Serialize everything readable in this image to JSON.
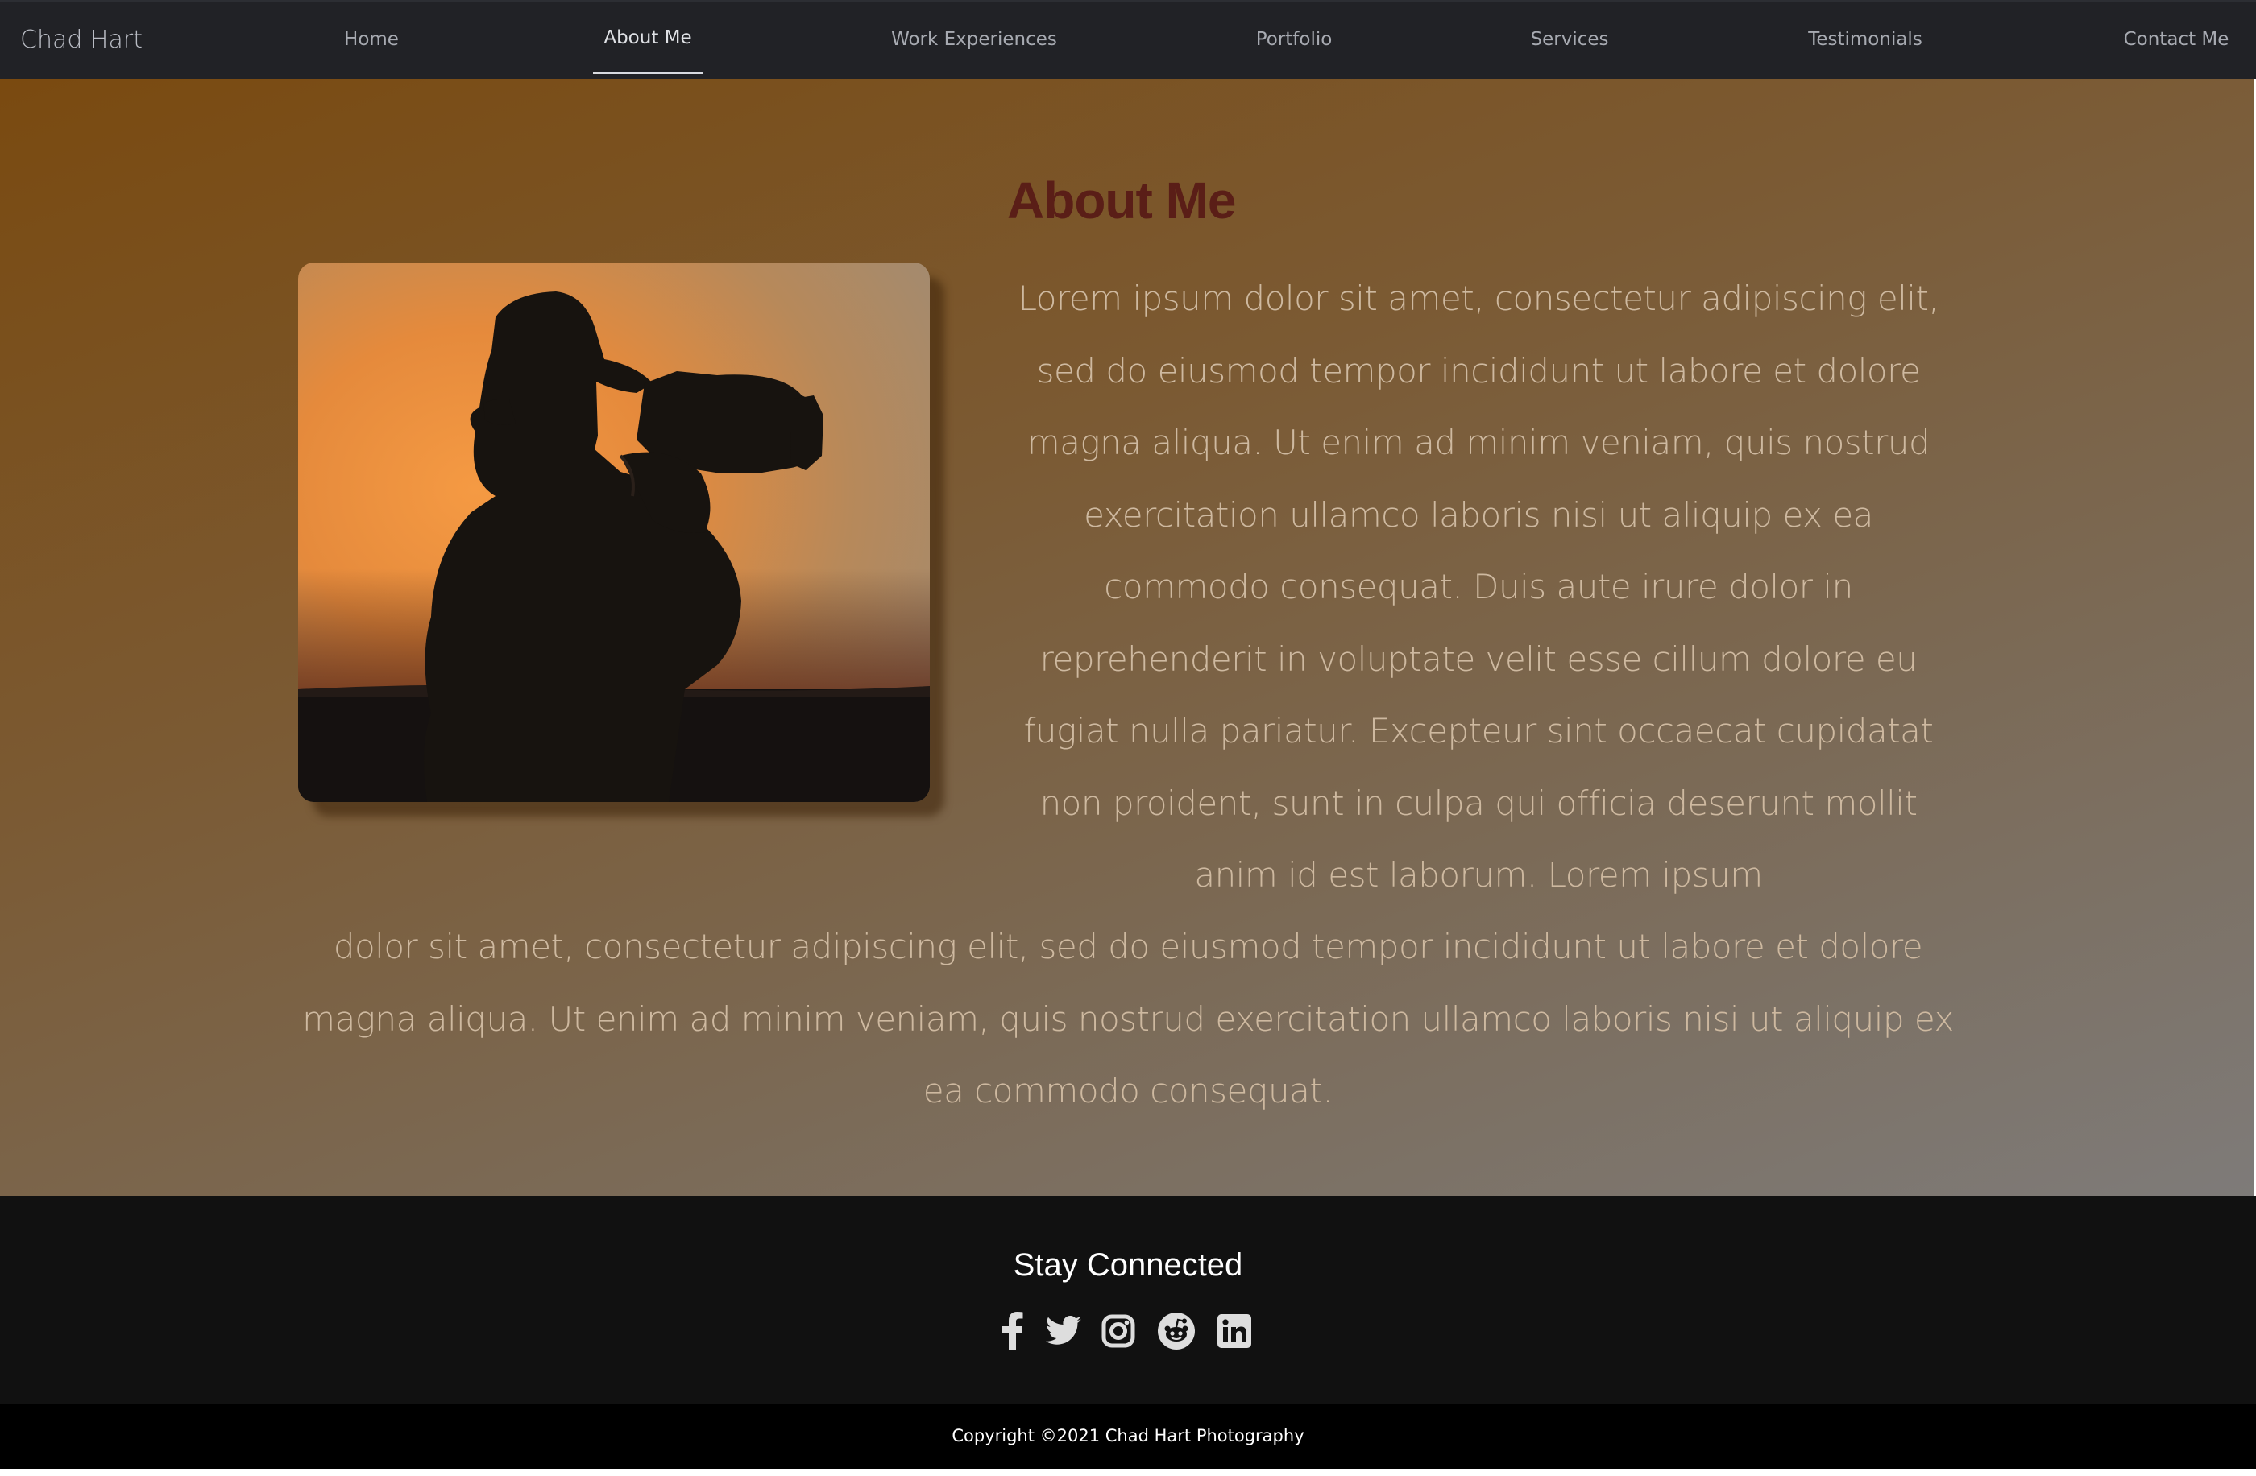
{
  "navbar": {
    "brand": "Chad Hart",
    "items": [
      {
        "label": "Home"
      },
      {
        "label": "About Me"
      },
      {
        "label": "Work Experiences"
      },
      {
        "label": "Portfolio"
      },
      {
        "label": "Services"
      },
      {
        "label": "Testimonials"
      },
      {
        "label": "Contact Me"
      }
    ],
    "active": "About Me"
  },
  "about": {
    "title": "About Me",
    "paragraph_top": "Lorem ipsum dolor sit amet, consectetur adipiscing elit, sed do eiusmod tempor incididunt ut labore et dolore magna aliqua. Ut enim ad minim veniam, quis nostrud exercitation ullamco laboris nisi ut aliquip ex ea commodo consequat. Duis aute irure dolor in reprehenderit in voluptate velit esse cillum dolore eu fugiat nulla pariatur. Excepteur sint occaecat cupidatat non proident, sunt in culpa qui officia deserunt mollit anim id est laborum. Lorem ipsum",
    "paragraph_bottom": "dolor sit amet, consectetur adipiscing elit, sed do eiusmod tempor incididunt ut labore et dolore magna aliqua. Ut enim ad minim veniam, quis nostrud exercitation ullamco laboris nisi ut aliquip ex ea commodo consequat."
  },
  "footer": {
    "title": "Stay Connected",
    "social_icons": [
      "facebook-icon",
      "twitter-icon",
      "instagram-icon",
      "reddit-icon",
      "linkedin-icon"
    ],
    "copyright": "Copyright ©2021 Chad Hart Photography"
  },
  "colors": {
    "nav_bg": "#212226",
    "title": "#5a1e17",
    "paragraph": "#ceb9a0",
    "footer_bg": "#111111",
    "icon": "#dddddd"
  }
}
